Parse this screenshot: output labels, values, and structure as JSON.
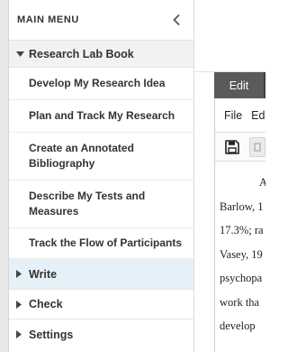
{
  "sidebar": {
    "header": {
      "title": "MAIN MENU",
      "collapse_icon": "chevron-left-icon"
    },
    "open_section": {
      "label": "Research Lab Book",
      "icon": "caret-down-icon",
      "items": [
        {
          "label": "Develop My Research Idea"
        },
        {
          "label": "Plan and Track My Research"
        },
        {
          "label": "Create an Annotated Bibliography"
        },
        {
          "label": "Describe My Tests and Measures"
        },
        {
          "label": "Track the Flow of Participants"
        }
      ]
    },
    "sections": [
      {
        "label": "Write",
        "icon": "caret-right-icon"
      },
      {
        "label": "Check",
        "icon": "caret-right-icon"
      },
      {
        "label": "Settings",
        "icon": "caret-right-icon"
      }
    ]
  },
  "editor": {
    "tab_label": "Edit",
    "menu": [
      "File",
      "Ed"
    ],
    "toolbar": {
      "save_icon": "save-icon"
    },
    "body_lines": [
      "A",
      "Barlow, 1",
      "17.3%; ra",
      "Vasey, 19",
      "psychopa",
      "work tha",
      "develop"
    ]
  },
  "colors": {
    "active_section_bg": "#e6f0f8",
    "open_section_bg": "#f2f2f2",
    "tab_bg": "#3f3f3f"
  }
}
